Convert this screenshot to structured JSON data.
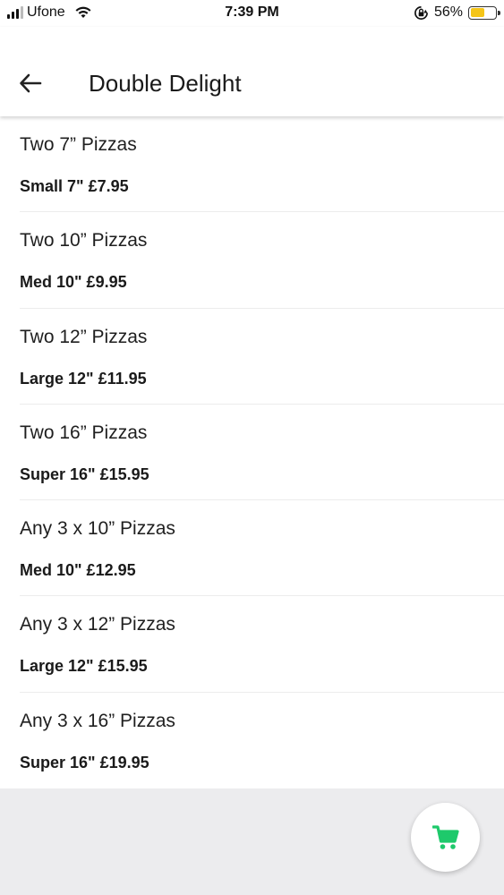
{
  "status_bar": {
    "carrier": "Ufone",
    "time": "7:39 PM",
    "battery_percent": "56%",
    "battery_level": 0.56,
    "battery_color": "#f5c518"
  },
  "header": {
    "back_icon": "arrow-left-icon",
    "title": "Double Delight"
  },
  "items": [
    {
      "name": "Two 7” Pizzas",
      "price": "Small 7\" £7.95"
    },
    {
      "name": "Two 10” Pizzas",
      "price": "Med 10\" £9.95"
    },
    {
      "name": "Two 12” Pizzas",
      "price": "Large 12\" £11.95"
    },
    {
      "name": "Two 16” Pizzas",
      "price": "Super 16\" £15.95"
    },
    {
      "name": "Any 3 x 10” Pizzas",
      "price": "Med 10\" £12.95"
    },
    {
      "name": "Any 3 x 12” Pizzas",
      "price": "Large 12\" £15.95"
    },
    {
      "name": "Any 3 x 16” Pizzas",
      "price": "Super 16\" £19.95"
    }
  ],
  "cart": {
    "icon": "shopping-cart-icon",
    "accent_color": "#1ec96b"
  }
}
